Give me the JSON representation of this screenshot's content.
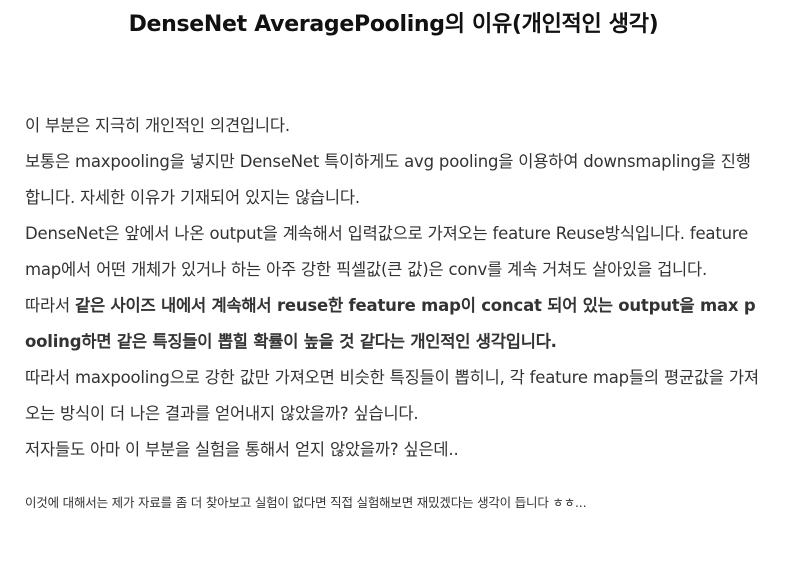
{
  "post": {
    "title": "DenseNet AveragePooling의 이유(개인적인 생각)",
    "paragraphs": {
      "p1": "이 부분은 지극히 개인적인 의견입니다.",
      "p2": "보통은 maxpooling을 넣지만 DenseNet 특이하게도 avg pooling을 이용하여 downsmapling을 진행합니다. 자세한 이유가 기재되어 있지는 않습니다.",
      "p3": "DenseNet은 앞에서 나온 output을 계속해서 입력값으로 가져오는 feature Reuse방식입니다. feature map에서 어떤 개체가 있거나 하는 아주 강한 픽셀값(큰 값)은 conv를 계속 거쳐도 살아있을 겁니다.",
      "p4_prefix": "따라서 ",
      "p4_bold": "같은 사이즈 내에서 계속해서 reuse한 feature map이 concat 되어 있는 output을 max pooling하면 같은 특징들이 뽑힐 확률이 높을 것 같다는 개인적인 생각입니다.",
      "p5": "따라서 maxpooling으로 강한 값만 가져오면 비슷한 특징들이 뽑히니, 각 feature map들의 평균값을 가져오는 방식이 더 나은 결과를 얻어내지 않았을까? 싶습니다.",
      "p6": "저자들도 아마 이 부분을 실험을 통해서 얻지 않았을까? 싶은데.."
    },
    "footnote": "이것에 대해서는 제가 자료를 좀 더 찾아보고 실험이 없다면 직접 실험해보면 재밌겠다는 생각이 듭니다 ㅎㅎ..."
  }
}
